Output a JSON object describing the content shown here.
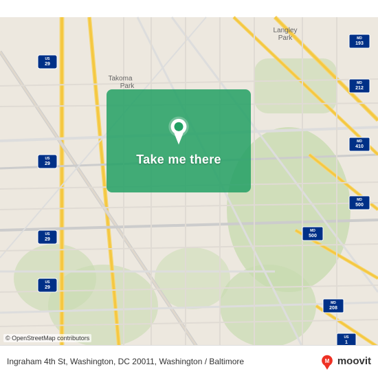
{
  "map": {
    "alt": "Map of Washington DC area showing Ingraham 4th St",
    "osm_attribution": "© OpenStreetMap contributors"
  },
  "action_overlay": {
    "button_label": "Take me there",
    "pin_alt": "location pin"
  },
  "bottom_bar": {
    "address": "Ingraham 4th St, Washington, DC 20011, Washington / Baltimore",
    "brand_name": "moovit",
    "brand_sub": "/ Baltimore"
  }
}
